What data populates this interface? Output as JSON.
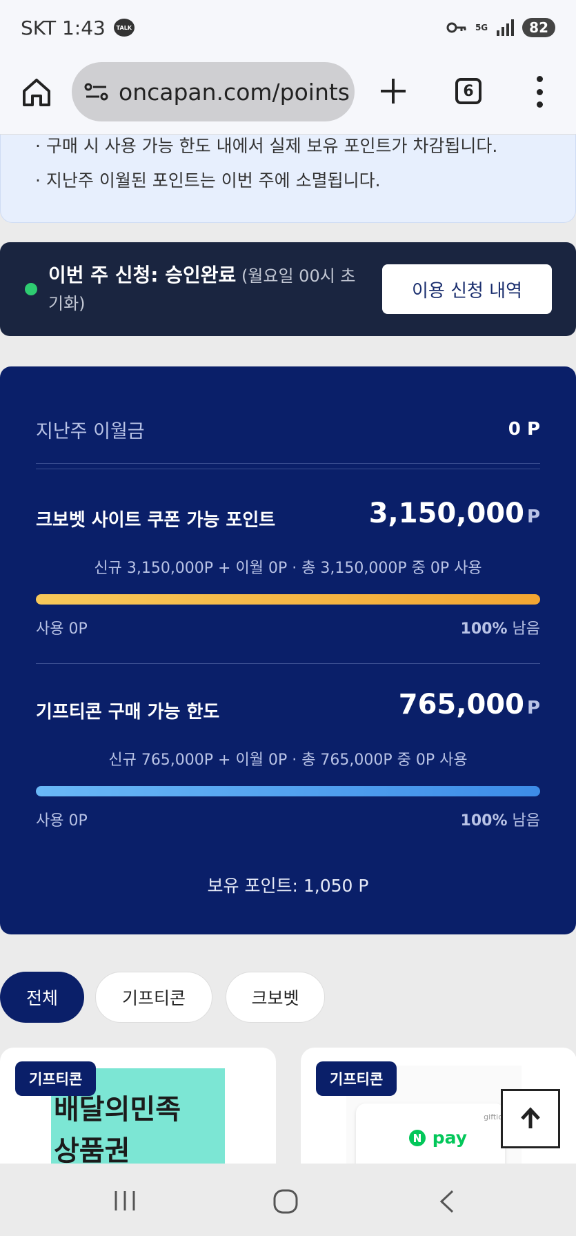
{
  "status_bar": {
    "carrier_time": "SKT 1:43",
    "talk_badge": "TALK",
    "network": "5G",
    "battery": "82"
  },
  "browser": {
    "url": "oncapan.com/points",
    "tab_count": "6"
  },
  "notice": {
    "lines": [
      "· 구매 시 사용 가능 한도 내에서 실제 보유 포인트가 차감됩니다.",
      "· 지난주 이월된 포인트는 이번 주에 소멸됩니다."
    ]
  },
  "application": {
    "status_label": "이번 주 신청: 승인완료",
    "reset_note": "(월요일 00시 초기화)",
    "history_button": "이용 신청 내역",
    "status_color": "#2ecc71"
  },
  "points": {
    "carryover_label": "지난주 이월금",
    "carryover_value": "0 P",
    "site_coupon": {
      "title": "크보벳 사이트 쿠폰 가능 포인트",
      "amount": "3,150,000",
      "unit": "P",
      "breakdown": "신규 3,150,000P + 이월 0P · 총 3,150,000P 중 0P 사용",
      "used": "사용 0P",
      "remaining_percent": "100%",
      "remaining_suffix": "남음",
      "remaining_fraction": 1.0
    },
    "gifticon_limit": {
      "title": "기프티콘 구매 가능 한도",
      "amount": "765,000",
      "unit": "P",
      "breakdown": "신규 765,000P + 이월 0P · 총 765,000P 중 0P 사용",
      "used": "사용 0P",
      "remaining_percent": "100%",
      "remaining_suffix": "남음",
      "remaining_fraction": 1.0
    },
    "held_points": "보유 포인트: 1,050 P"
  },
  "filters": [
    "전체",
    "기프티콘",
    "크보벳"
  ],
  "products": [
    {
      "badge": "기프티콘",
      "thumb_line1": "배달의민족",
      "thumb_line2": "상품권"
    },
    {
      "badge": "기프티콘",
      "thumb_brand": "pay",
      "thumb_tag": "gifticon"
    }
  ],
  "colors": {
    "primary_navy": "#0a1f69",
    "dark_bar": "#1a2540",
    "accent_yellow": "#f3a632",
    "accent_blue": "#3d8ce8"
  }
}
